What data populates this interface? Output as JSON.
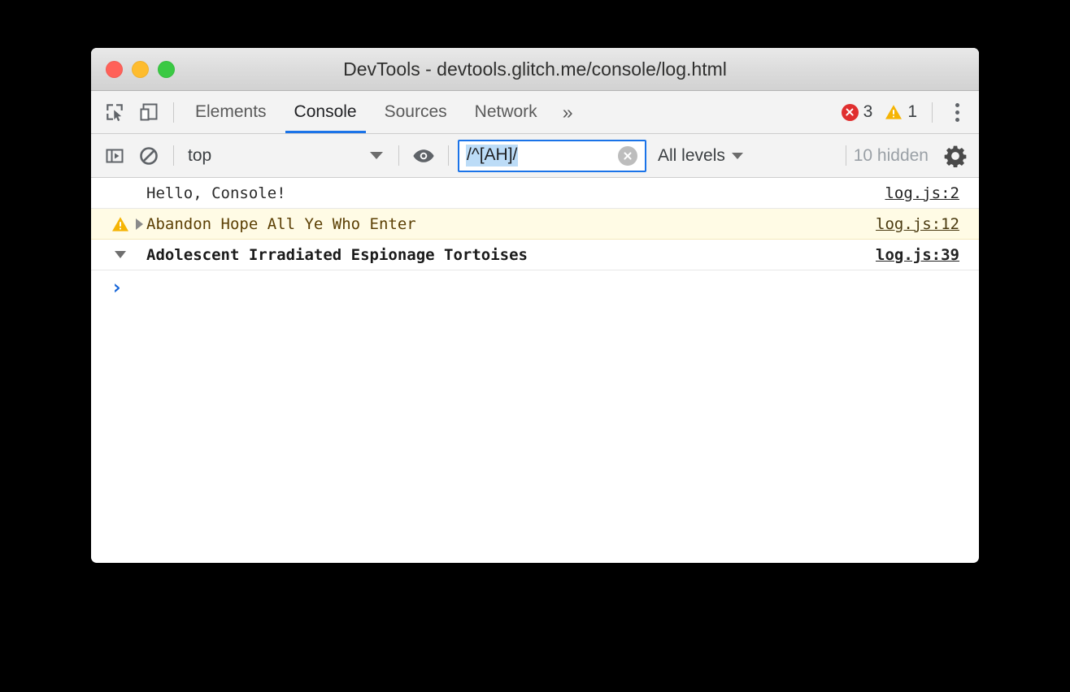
{
  "window": {
    "title": "DevTools - devtools.glitch.me/console/log.html",
    "traffic_lights": [
      "close",
      "minimize",
      "zoom"
    ]
  },
  "tabbar": {
    "inspect_icon": "inspect-element-icon",
    "device_icon": "device-toolbar-icon",
    "tabs": [
      {
        "label": "Elements",
        "active": false
      },
      {
        "label": "Console",
        "active": true
      },
      {
        "label": "Sources",
        "active": false
      },
      {
        "label": "Network",
        "active": false
      }
    ],
    "more_tabs_label": "»",
    "error_count": "3",
    "warning_count": "1",
    "menu_icon": "vertical-kebab-icon"
  },
  "console_toolbar": {
    "sidebar_toggle_icon": "console-sidebar-toggle-icon",
    "clear_icon": "clear-console-icon",
    "context": "top",
    "eye_icon": "live-expression-eye-icon",
    "filter": {
      "value": "/^[AH]/",
      "placeholder": "Filter",
      "selected": true,
      "clear_label": "clear-filter"
    },
    "levels": "All levels",
    "hidden_count": "10 hidden",
    "settings_icon": "settings-gear-icon"
  },
  "console_messages": [
    {
      "level": "log",
      "icon": "",
      "disclosure": "",
      "text": "Hello, Console!",
      "source": "log.js:2"
    },
    {
      "level": "warning",
      "icon": "warning-triangle-icon",
      "disclosure": "collapsed",
      "text": "Abandon Hope All Ye Who Enter",
      "source": "log.js:12"
    },
    {
      "level": "group",
      "icon": "",
      "disclosure": "expanded",
      "text": "Adolescent Irradiated Espionage Tortoises",
      "source": "log.js:39"
    }
  ],
  "prompt": {
    "chevron": "›"
  },
  "colors": {
    "accent": "#1a73e8",
    "error": "#e02f2f",
    "warning": "#f5b404",
    "warning_row_bg": "#fffbe5",
    "warning_text": "#5c4005",
    "selection": "#bcdcf7",
    "page_bg": "#000000"
  }
}
